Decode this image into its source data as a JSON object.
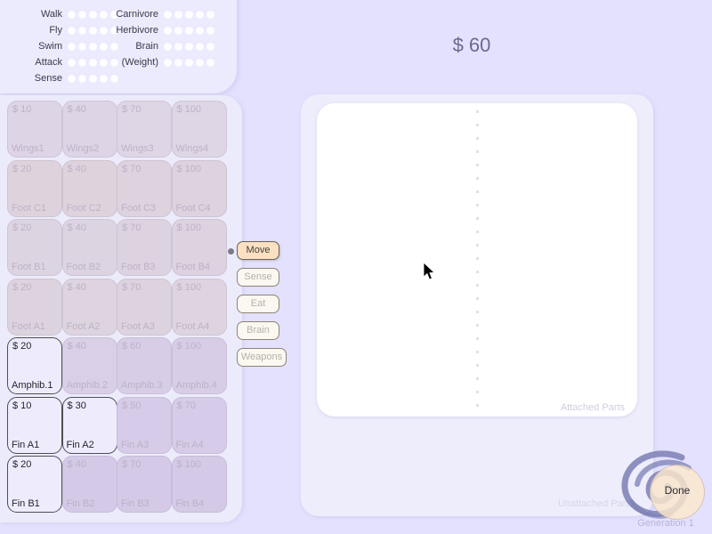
{
  "background_color": "#e3e1fd",
  "stats": {
    "left_column": [
      {
        "label": "Walk",
        "dots": 5,
        "filled": 0
      },
      {
        "label": "Fly",
        "dots": 5,
        "filled": 0
      },
      {
        "label": "Swim",
        "dots": 5,
        "filled": 0
      },
      {
        "label": "Attack",
        "dots": 5,
        "filled": 0
      },
      {
        "label": "Sense",
        "dots": 5,
        "filled": 0
      }
    ],
    "right_column": [
      {
        "label": "Carnivore",
        "dots": 5,
        "filled": 0
      },
      {
        "label": "Herbivore",
        "dots": 5,
        "filled": 0
      },
      {
        "label": "Brain",
        "dots": 5,
        "filled": 0
      },
      {
        "label": "(Weight)",
        "dots": 5,
        "filled": 0
      }
    ]
  },
  "money": {
    "amount_label": "$ 60"
  },
  "parts_grid": {
    "columns": 4,
    "rows": 8,
    "tiles": [
      {
        "price": "$ 10",
        "name": "Wings1",
        "enabled": false,
        "fill": "#ddd4e5"
      },
      {
        "price": "$ 40",
        "name": "Wings2",
        "enabled": false,
        "fill": "#ddd4e5"
      },
      {
        "price": "$ 70",
        "name": "Wings3",
        "enabled": false,
        "fill": "#ded6e5"
      },
      {
        "price": "$ 100",
        "name": "Wings4",
        "enabled": false,
        "fill": "#ded6e5"
      },
      {
        "price": "$ 20",
        "name": "Foot C1",
        "enabled": false,
        "fill": "#ded3dd"
      },
      {
        "price": "$ 40",
        "name": "Foot C2",
        "enabled": false,
        "fill": "#ded3dd"
      },
      {
        "price": "$ 70",
        "name": "Foot C3",
        "enabled": false,
        "fill": "#ddd2dd"
      },
      {
        "price": "$ 100",
        "name": "Foot C4",
        "enabled": false,
        "fill": "#ddd2dd"
      },
      {
        "price": "$ 20",
        "name": "Foot B1",
        "enabled": false,
        "fill": "#ddd4e1"
      },
      {
        "price": "$ 40",
        "name": "Foot B2",
        "enabled": false,
        "fill": "#ddd4e1"
      },
      {
        "price": "$ 70",
        "name": "Foot B3",
        "enabled": false,
        "fill": "#ddd3e0"
      },
      {
        "price": "$ 100",
        "name": "Foot B4",
        "enabled": false,
        "fill": "#ddd3e0"
      },
      {
        "price": "$ 20",
        "name": "Foot A1",
        "enabled": false,
        "fill": "#ddd3de"
      },
      {
        "price": "$ 40",
        "name": "Foot A2",
        "enabled": false,
        "fill": "#ddd4df"
      },
      {
        "price": "$ 70",
        "name": "Foot A3",
        "enabled": false,
        "fill": "#ddd3de"
      },
      {
        "price": "$ 100",
        "name": "Foot A4",
        "enabled": false,
        "fill": "#ded4df"
      },
      {
        "price": "$ 20",
        "name": "Amphib.1",
        "enabled": true,
        "fill": "#eeecfc"
      },
      {
        "price": "$ 40",
        "name": "Amphib.2",
        "enabled": false,
        "fill": "#d9cfe6"
      },
      {
        "price": "$ 60",
        "name": "Amphib.3",
        "enabled": false,
        "fill": "#d8cde7"
      },
      {
        "price": "$ 100",
        "name": "Amphib.4",
        "enabled": false,
        "fill": "#d8cde7"
      },
      {
        "price": "$ 10",
        "name": "Fin A1",
        "enabled": true,
        "fill": "#eeecfc"
      },
      {
        "price": "$ 30",
        "name": "Fin A2",
        "enabled": true,
        "fill": "#eeecfc"
      },
      {
        "price": "$ 50",
        "name": "Fin A3",
        "enabled": false,
        "fill": "#d6cbe8"
      },
      {
        "price": "$ 70",
        "name": "Fin A4",
        "enabled": false,
        "fill": "#d6cbe8"
      },
      {
        "price": "$ 20",
        "name": "Fin B1",
        "enabled": true,
        "fill": "#e6e3fa"
      },
      {
        "price": "$ 40",
        "name": "Fin B2",
        "enabled": false,
        "fill": "#d4c9e7"
      },
      {
        "price": "$ 70",
        "name": "Fin B3",
        "enabled": false,
        "fill": "#d4c9e7"
      },
      {
        "price": "$ 100",
        "name": "Fin B4",
        "enabled": false,
        "fill": "#d4c9e7"
      }
    ]
  },
  "categories": {
    "selected": "Move",
    "items": [
      {
        "label": "Move"
      },
      {
        "label": "Sense"
      },
      {
        "label": "Eat"
      },
      {
        "label": "Brain"
      },
      {
        "label": "Weapons"
      }
    ]
  },
  "editor": {
    "attached_label": "Attached Parts",
    "unattached_label": "Unattached Parts"
  },
  "footer": {
    "done_label": "Done",
    "generation_label": "Generation 1"
  },
  "icons": {
    "cursor": "mouse-pointer-icon",
    "logo": "spiral-logo-icon",
    "connector": "connector-dot-icon"
  }
}
